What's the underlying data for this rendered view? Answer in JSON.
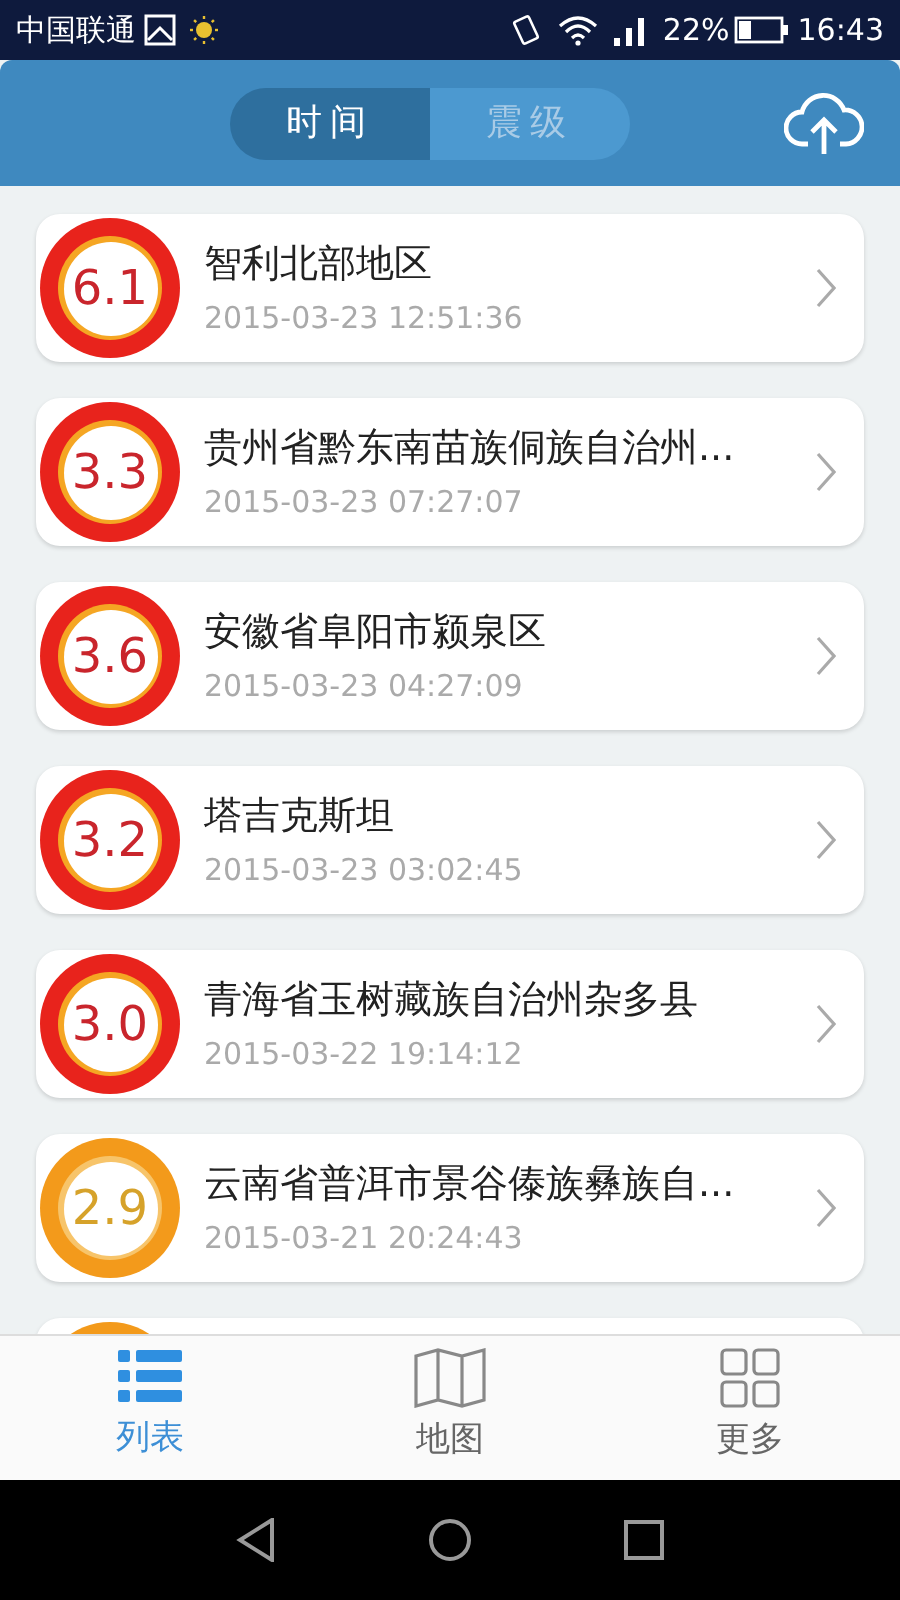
{
  "status_bar": {
    "carrier": "中国联通",
    "battery": "22%",
    "time": "16:43"
  },
  "header": {
    "tabs": [
      {
        "label": "时间",
        "selected": true
      },
      {
        "label": "震级",
        "selected": false
      }
    ]
  },
  "quakes": [
    {
      "magnitude": "6.1",
      "place": "智利北部地区",
      "time": "2015-03-23 12:51:36",
      "color": "#e8231c"
    },
    {
      "magnitude": "3.3",
      "place": "贵州省黔东南苗族侗族自治州...",
      "time": "2015-03-23 07:27:07",
      "color": "#e8231c"
    },
    {
      "magnitude": "3.6",
      "place": "安徽省阜阳市颍泉区",
      "time": "2015-03-23 04:27:09",
      "color": "#e8231c"
    },
    {
      "magnitude": "3.2",
      "place": "塔吉克斯坦",
      "time": "2015-03-23 03:02:45",
      "color": "#e8231c"
    },
    {
      "magnitude": "3.0",
      "place": "青海省玉树藏族自治州杂多县",
      "time": "2015-03-22 19:14:12",
      "color": "#e8231c"
    },
    {
      "magnitude": "2.9",
      "place": "云南省普洱市景谷傣族彝族自...",
      "time": "2015-03-21 20:24:43",
      "color": "#f39a1b"
    },
    {
      "color": "#f39a1b"
    }
  ],
  "tab_bar": [
    {
      "label": "列表",
      "kind": "list",
      "selected": true
    },
    {
      "label": "地图",
      "kind": "map",
      "selected": false
    },
    {
      "label": "更多",
      "kind": "more",
      "selected": false
    }
  ]
}
